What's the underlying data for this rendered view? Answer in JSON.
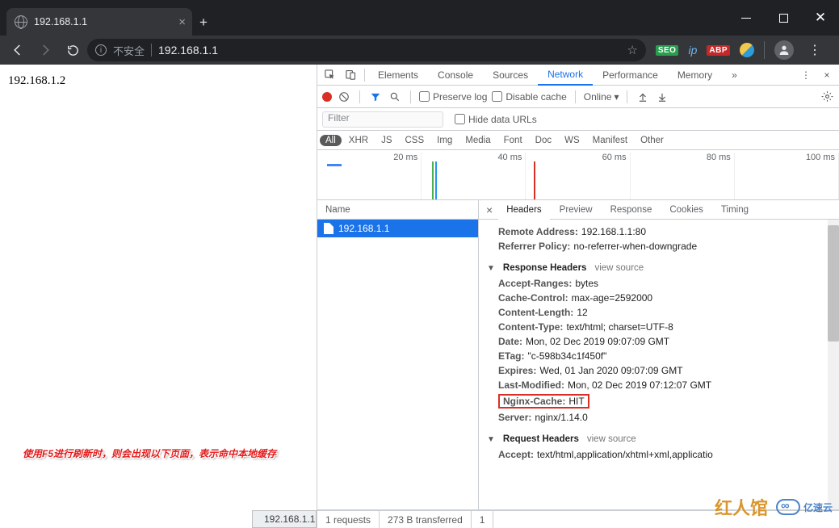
{
  "chrome": {
    "tab_title": "192.168.1.1",
    "insecure_label": "不安全",
    "url_display": "192.168.1.1",
    "win": {
      "min": "",
      "max": "",
      "close": "✕"
    },
    "ext": {
      "seo": "SEO",
      "ip": "ip",
      "abp": "ABP"
    }
  },
  "page_body": "192.168.1.2",
  "status_left": "192.168.1.1",
  "annotation": {
    "prefix": "使用",
    "key": "F5",
    "suffix": "进行刷新时，则会出现以下页面，表示命中本地缓存"
  },
  "devtools": {
    "tabs": [
      "Elements",
      "Console",
      "Sources",
      "Network",
      "Performance",
      "Memory"
    ],
    "more": "»",
    "toolbar": {
      "preserve": "Preserve log",
      "disable_cache": "Disable cache",
      "online": "Online"
    },
    "filter_placeholder": "Filter",
    "hide_urls": "Hide data URLs",
    "types": [
      "All",
      "XHR",
      "JS",
      "CSS",
      "Img",
      "Media",
      "Font",
      "Doc",
      "WS",
      "Manifest",
      "Other"
    ],
    "wf_ticks": [
      "20 ms",
      "40 ms",
      "60 ms",
      "80 ms",
      "100 ms"
    ],
    "name_header": "Name",
    "request_name": "192.168.1.1",
    "detail_tabs": [
      "Headers",
      "Preview",
      "Response",
      "Cookies",
      "Timing"
    ],
    "general": {
      "remote_addr_k": "Remote Address:",
      "remote_addr_v": "192.168.1.1:80",
      "referrer_k": "Referrer Policy:",
      "referrer_v": "no-referrer-when-downgrade"
    },
    "resp_sec": {
      "title": "Response Headers",
      "view_src": "view source"
    },
    "resp_headers": [
      {
        "k": "Accept-Ranges:",
        "v": "bytes"
      },
      {
        "k": "Cache-Control:",
        "v": "max-age=2592000"
      },
      {
        "k": "Content-Length:",
        "v": "12"
      },
      {
        "k": "Content-Type:",
        "v": "text/html; charset=UTF-8"
      },
      {
        "k": "Date:",
        "v": "Mon, 02 Dec 2019 09:07:09 GMT"
      },
      {
        "k": "ETag:",
        "v": "\"c-598b34c1f450f\""
      },
      {
        "k": "Expires:",
        "v": "Wed, 01 Jan 2020 09:07:09 GMT"
      },
      {
        "k": "Last-Modified:",
        "v": "Mon, 02 Dec 2019 07:12:07 GMT"
      },
      {
        "k": "Nginx-Cache:",
        "v": "HIT"
      },
      {
        "k": "Server:",
        "v": "nginx/1.14.0"
      }
    ],
    "req_sec": {
      "title": "Request Headers",
      "view_src": "view source"
    },
    "req_headers": [
      {
        "k": "Accept:",
        "v": "text/html,application/xhtml+xml,applicatio"
      }
    ],
    "status": {
      "reqs": "1 requests",
      "xfer": "273 B transferred",
      "res": "1"
    }
  },
  "watermark1": "红人馆",
  "watermark2": "亿速云"
}
